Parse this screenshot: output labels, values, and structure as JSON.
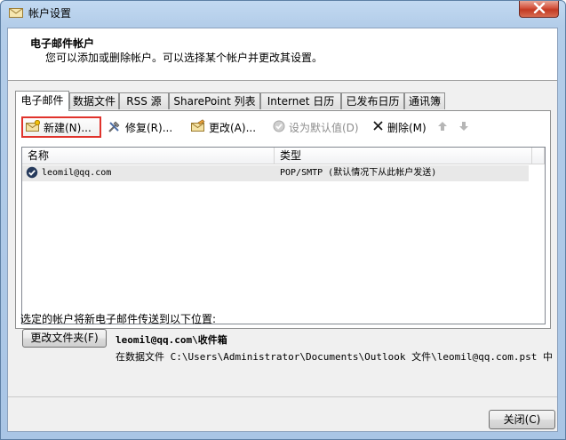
{
  "window": {
    "title": "帐户设置"
  },
  "header": {
    "title": "电子邮件帐户",
    "subtitle": "您可以添加或删除帐户。可以选择某个帐户并更改其设置。"
  },
  "tabs": [
    {
      "label": "电子邮件",
      "active": true
    },
    {
      "label": "数据文件"
    },
    {
      "label": "RSS 源"
    },
    {
      "label": "SharePoint 列表"
    },
    {
      "label": "Internet 日历"
    },
    {
      "label": "已发布日历"
    },
    {
      "label": "通讯簿"
    }
  ],
  "toolbar": {
    "new_label": "新建(N)...",
    "repair_label": "修复(R)...",
    "change_label": "更改(A)...",
    "default_label": "设为默认值(D)",
    "remove_label": "删除(M)"
  },
  "list": {
    "columns": [
      "名称",
      "类型"
    ],
    "rows": [
      {
        "name": "leomil@qq.com",
        "type": "POP/SMTP (默认情况下从此帐户发送)"
      }
    ]
  },
  "delivery": {
    "description": "选定的帐户将新电子邮件传送到以下位置:",
    "change_folder_label": "更改文件夹(F)",
    "inbox": "leomil@qq.com\\收件箱",
    "path": "在数据文件 C:\\Users\\Administrator\\Documents\\Outlook 文件\\leomil@qq.com.pst 中"
  },
  "footer": {
    "close_label": "关闭(C)"
  },
  "colors": {
    "accent_red": "#e0332c",
    "title_gradient": "#b3cde9",
    "close_red": "#c23a22"
  },
  "icons": {
    "title": "mail-settings-icon",
    "new": "new-account-icon",
    "repair": "repair-tools-icon",
    "change": "change-account-icon",
    "default": "check-circle-icon",
    "remove": "remove-x-icon",
    "up": "arrow-up-icon",
    "down": "arrow-down-icon",
    "row": "account-check-icon"
  }
}
